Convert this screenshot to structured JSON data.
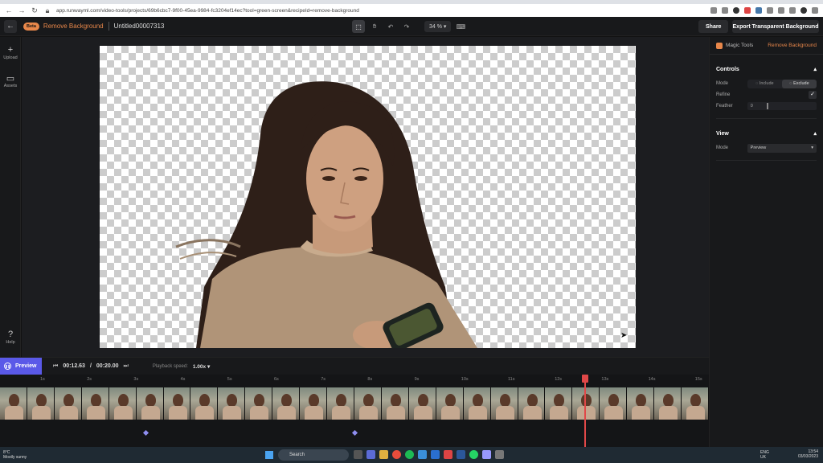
{
  "browser": {
    "url": "app.runwayml.com/video-tools/projects/69b6cbc7-9f00-45ea-9984-fc3204ef14ec?tool=green-screen&recipeId=remove-background"
  },
  "header": {
    "beta": "Beta",
    "tool_name": "Remove Background",
    "project_name": "Untitled00007313",
    "zoom": "34 %",
    "share_label": "Share",
    "export_label": "Export Transparent Background"
  },
  "sidebar": {
    "upload_label": "Upload",
    "assets_label": "Assets",
    "help_label": "Help"
  },
  "panel": {
    "magic_tools": "Magic Tools",
    "recipe": "Remove Background",
    "controls_title": "Controls",
    "mode_label": "Mode",
    "include_label": "Include",
    "exclude_label": "Exclude",
    "refine_label": "Refine",
    "feather_label": "Feather",
    "feather_value": "0",
    "view_title": "View",
    "view_mode_label": "Mode",
    "view_mode_value": "Preview"
  },
  "playback": {
    "preview_label": "Preview",
    "current_time": "00:12.63",
    "separator": "/",
    "total_time": "00:20.00",
    "speed_label": "Playback speed:",
    "speed_value": "1.00x"
  },
  "timeline": {
    "ticks": [
      "1s",
      "2s",
      "3s",
      "4s",
      "5s",
      "6s",
      "7s",
      "8s",
      "9s",
      "10s",
      "11s",
      "12s",
      "13s",
      "14s",
      "15s"
    ],
    "playhead_seconds": 12.63
  },
  "taskbar": {
    "temp": "8°C",
    "weather": "Mostly sunny",
    "search": "Search",
    "lang1": "ENG",
    "lang2": "UK",
    "time": "13:54",
    "date": "03/03/2023"
  },
  "colors": {
    "accent": "#e8874a",
    "preview": "#5a59e8",
    "playhead": "#e04848"
  }
}
